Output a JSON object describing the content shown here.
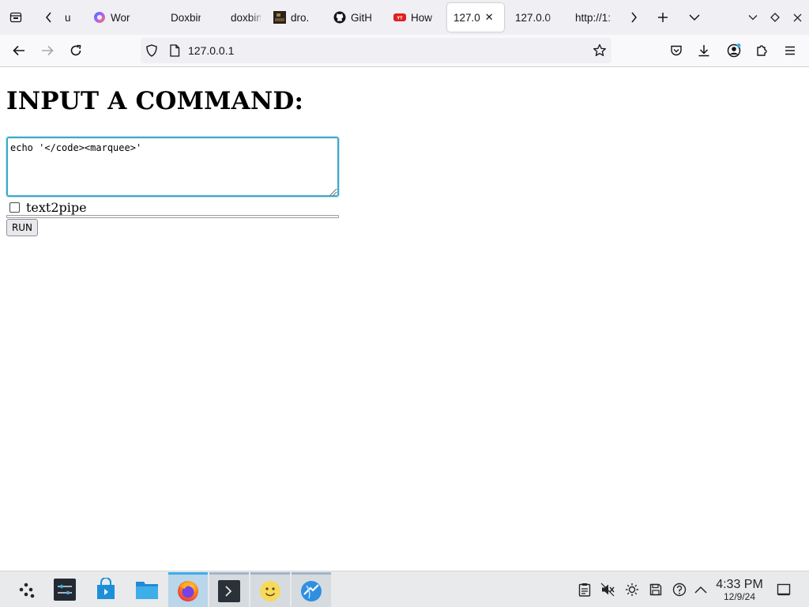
{
  "browser": {
    "tabs": [
      {
        "title": "u",
        "favicon": "generic"
      },
      {
        "title": "Wor",
        "favicon": "copilot"
      },
      {
        "title": "Doxbin",
        "favicon": "none"
      },
      {
        "title": "doxbin.",
        "favicon": "none"
      },
      {
        "title": "dro.",
        "favicon": "dark-thumb"
      },
      {
        "title": "GitH",
        "favicon": "github"
      },
      {
        "title": "How",
        "favicon": "youtube"
      },
      {
        "title": "127.0",
        "favicon": "none",
        "active": true
      },
      {
        "title": "127.0.0",
        "favicon": "none"
      },
      {
        "title": "http://1:",
        "favicon": "none"
      }
    ],
    "url": "127.0.0.1"
  },
  "page": {
    "heading": "INPUT A COMMAND:",
    "command_value": "echo '</code><marquee>'",
    "checkbox_label": "text2pipe",
    "checkbox_checked": false,
    "run_label": "RUN"
  },
  "taskbar": {
    "apps": [
      "app-launcher",
      "system-settings",
      "discover",
      "dolphin-files",
      "firefox",
      "konsole",
      "smiley-app",
      "krdc"
    ],
    "tray": [
      "clipboard",
      "volume-muted",
      "brightness",
      "save",
      "update",
      "expand-arrow"
    ],
    "time": "4:33 PM",
    "date": "12/9/24"
  },
  "colors": {
    "accent": "#3daee9",
    "focus_border": "#3fa9c9",
    "tab_strip": "#f0f0f4"
  }
}
